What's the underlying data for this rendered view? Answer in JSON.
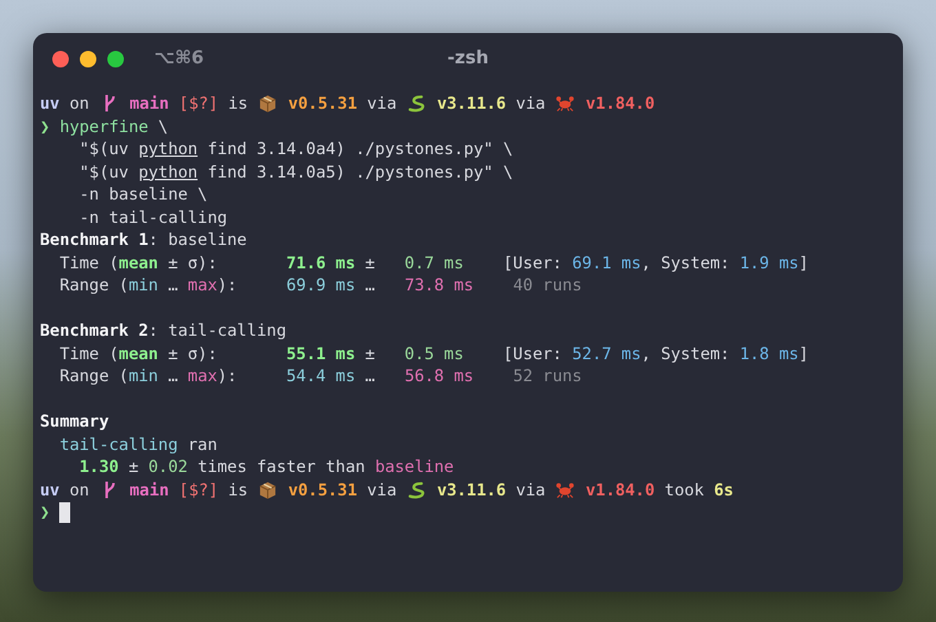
{
  "window": {
    "shortcut": "⌥⌘6",
    "title": "-zsh"
  },
  "lines": [
    [
      {
        "text": "uv",
        "kind": "dir"
      },
      {
        "text": " on ",
        "kind": "plain"
      },
      {
        "kind": "branch-icon"
      },
      {
        "text": " main ",
        "kind": "branch"
      },
      {
        "text": "[$?]",
        "kind": "status"
      },
      {
        "text": " is ",
        "kind": "plain"
      },
      {
        "kind": "package-icon"
      },
      {
        "text": " v0.5.31",
        "kind": "version"
      },
      {
        "text": " via ",
        "kind": "plain"
      },
      {
        "kind": "snake-icon"
      },
      {
        "text": " v3.11.6",
        "kind": "python"
      },
      {
        "text": " via ",
        "kind": "plain"
      },
      {
        "kind": "crab-icon"
      },
      {
        "text": " v1.84.0",
        "kind": "rust"
      }
    ],
    [
      {
        "text": "❯",
        "kind": "prompt"
      },
      {
        "text": " hyperfine",
        "kind": "command"
      },
      {
        "text": " \\",
        "kind": "plain"
      }
    ],
    [
      {
        "text": "    \"$(uv ",
        "kind": "plain"
      },
      {
        "text": "python",
        "kind": "underline"
      },
      {
        "text": " find 3.14.0a4) ./pystones.py\" \\",
        "kind": "plain"
      }
    ],
    [
      {
        "text": "    \"$(uv ",
        "kind": "plain"
      },
      {
        "text": "python",
        "kind": "underline"
      },
      {
        "text": " find 3.14.0a5) ./pystones.py\" \\",
        "kind": "plain"
      }
    ],
    [
      {
        "text": "    -n baseline \\",
        "kind": "plain"
      }
    ],
    [
      {
        "text": "    -n tail-calling",
        "kind": "plain"
      }
    ],
    [
      {
        "text": "Benchmark 1",
        "kind": "bold"
      },
      {
        "text": ": baseline",
        "kind": "plain"
      }
    ],
    [
      {
        "text": "  Time (",
        "kind": "plain"
      },
      {
        "text": "mean",
        "kind": "mean"
      },
      {
        "text": " ± σ):       ",
        "kind": "plain"
      },
      {
        "text": "71.6 ms",
        "kind": "mean"
      },
      {
        "text": " ±   ",
        "kind": "plain"
      },
      {
        "text": "0.7 ms",
        "kind": "stddev"
      },
      {
        "text": "    [User: ",
        "kind": "plain"
      },
      {
        "text": "69.1 ms",
        "kind": "user"
      },
      {
        "text": ", System: ",
        "kind": "plain"
      },
      {
        "text": "1.9 ms",
        "kind": "user"
      },
      {
        "text": "]",
        "kind": "plain"
      }
    ],
    [
      {
        "text": "  Range (",
        "kind": "plain"
      },
      {
        "text": "min",
        "kind": "min"
      },
      {
        "text": " … ",
        "kind": "plain"
      },
      {
        "text": "max",
        "kind": "max"
      },
      {
        "text": "):     ",
        "kind": "plain"
      },
      {
        "text": "69.9 ms",
        "kind": "min"
      },
      {
        "text": " …   ",
        "kind": "plain"
      },
      {
        "text": "73.8 ms",
        "kind": "max"
      },
      {
        "text": "    40 runs",
        "kind": "runs"
      }
    ],
    [
      {
        "kind": "blank"
      }
    ],
    [
      {
        "text": "Benchmark 2",
        "kind": "bold"
      },
      {
        "text": ": tail-calling",
        "kind": "plain"
      }
    ],
    [
      {
        "text": "  Time (",
        "kind": "plain"
      },
      {
        "text": "mean",
        "kind": "mean"
      },
      {
        "text": " ± σ):       ",
        "kind": "plain"
      },
      {
        "text": "55.1 ms",
        "kind": "mean"
      },
      {
        "text": " ±   ",
        "kind": "plain"
      },
      {
        "text": "0.5 ms",
        "kind": "stddev"
      },
      {
        "text": "    [User: ",
        "kind": "plain"
      },
      {
        "text": "52.7 ms",
        "kind": "user"
      },
      {
        "text": ", System: ",
        "kind": "plain"
      },
      {
        "text": "1.8 ms",
        "kind": "user"
      },
      {
        "text": "]",
        "kind": "plain"
      }
    ],
    [
      {
        "text": "  Range (",
        "kind": "plain"
      },
      {
        "text": "min",
        "kind": "min"
      },
      {
        "text": " … ",
        "kind": "plain"
      },
      {
        "text": "max",
        "kind": "max"
      },
      {
        "text": "):     ",
        "kind": "plain"
      },
      {
        "text": "54.4 ms",
        "kind": "min"
      },
      {
        "text": " …   ",
        "kind": "plain"
      },
      {
        "text": "56.8 ms",
        "kind": "max"
      },
      {
        "text": "    52 runs",
        "kind": "runs"
      }
    ],
    [
      {
        "kind": "blank"
      }
    ],
    [
      {
        "text": "Summary",
        "kind": "bold"
      }
    ],
    [
      {
        "text": "  tail-calling",
        "kind": "min"
      },
      {
        "text": " ran",
        "kind": "plain"
      }
    ],
    [
      {
        "text": "    1.30",
        "kind": "mean"
      },
      {
        "text": " ± ",
        "kind": "plain"
      },
      {
        "text": "0.02",
        "kind": "stddev"
      },
      {
        "text": " times faster than ",
        "kind": "plain"
      },
      {
        "text": "baseline",
        "kind": "max"
      }
    ],
    [
      {
        "text": "uv",
        "kind": "dir"
      },
      {
        "text": " on ",
        "kind": "plain"
      },
      {
        "kind": "branch-icon"
      },
      {
        "text": " main ",
        "kind": "branch"
      },
      {
        "text": "[$?]",
        "kind": "status"
      },
      {
        "text": " is ",
        "kind": "plain"
      },
      {
        "kind": "package-icon"
      },
      {
        "text": " v0.5.31",
        "kind": "version"
      },
      {
        "text": " via ",
        "kind": "plain"
      },
      {
        "kind": "snake-icon"
      },
      {
        "text": " v3.11.6",
        "kind": "python"
      },
      {
        "text": " via ",
        "kind": "plain"
      },
      {
        "kind": "crab-icon"
      },
      {
        "text": " v1.84.0",
        "kind": "rust"
      },
      {
        "text": " took ",
        "kind": "plain"
      },
      {
        "text": "6s",
        "kind": "python"
      }
    ],
    [
      {
        "text": "❯",
        "kind": "prompt"
      },
      {
        "kind": "cursor"
      }
    ]
  ]
}
